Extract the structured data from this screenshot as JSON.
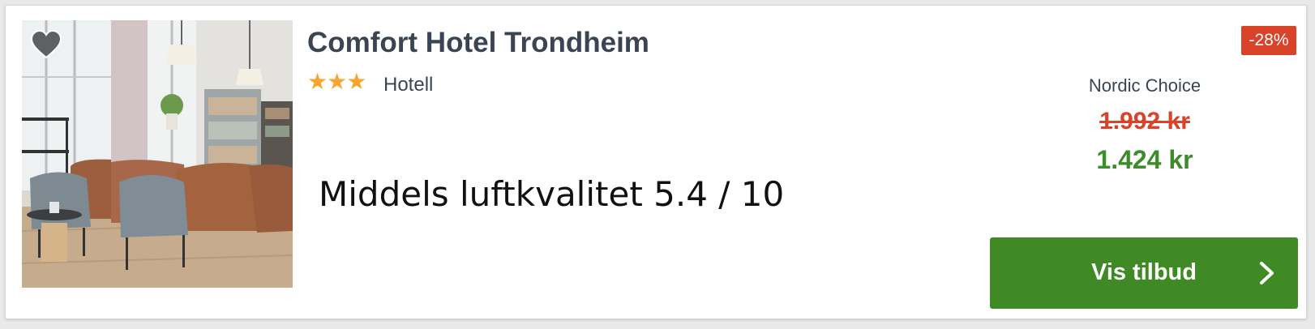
{
  "hotel": {
    "name": "Comfort Hotel Trondheim",
    "stars": "★★★",
    "star_count": 3,
    "type": "Hotell",
    "air_quality": "Middels luftkvalitet 5.4 / 10"
  },
  "offer": {
    "discount": "-28%",
    "provider": "Nordic Choice",
    "old_price": "1.992 kr",
    "new_price": "1.424 kr",
    "cta_label": "Vis tilbud"
  },
  "icons": {
    "favorite": "heart-icon",
    "cta": "chevron-right-icon"
  },
  "colors": {
    "discount_badge": "#d9432a",
    "new_price": "#3d8b2a",
    "cta_background": "#408a25",
    "stars": "#f6a530",
    "title": "#3a4452"
  }
}
